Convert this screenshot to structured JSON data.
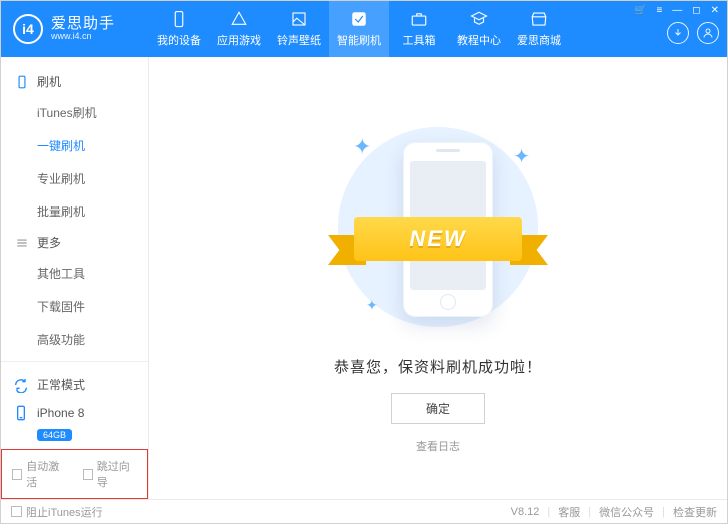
{
  "logo": {
    "title": "爱思助手",
    "url": "www.i4.cn",
    "badge": "i4"
  },
  "tabs": [
    {
      "label": "我的设备"
    },
    {
      "label": "应用游戏"
    },
    {
      "label": "铃声壁纸"
    },
    {
      "label": "智能刷机"
    },
    {
      "label": "工具箱"
    },
    {
      "label": "教程中心"
    },
    {
      "label": "爱思商城"
    }
  ],
  "sidebar": {
    "sec1": "刷机",
    "items1": [
      "iTunes刷机",
      "一键刷机",
      "专业刷机",
      "批量刷机"
    ],
    "sec2": "更多",
    "items2": [
      "其他工具",
      "下载固件",
      "高级功能"
    ],
    "mode": "正常模式",
    "device": "iPhone 8",
    "storage": "64GB",
    "auto_activate": "自动激活",
    "skip_guide": "跳过向导"
  },
  "content": {
    "ribbon": "NEW",
    "message": "恭喜您，保资料刷机成功啦！",
    "ok": "确定",
    "log": "查看日志"
  },
  "footer": {
    "block_itunes": "阻止iTunes运行",
    "version": "V8.12",
    "support": "客服",
    "wechat": "微信公众号",
    "update": "检查更新"
  }
}
